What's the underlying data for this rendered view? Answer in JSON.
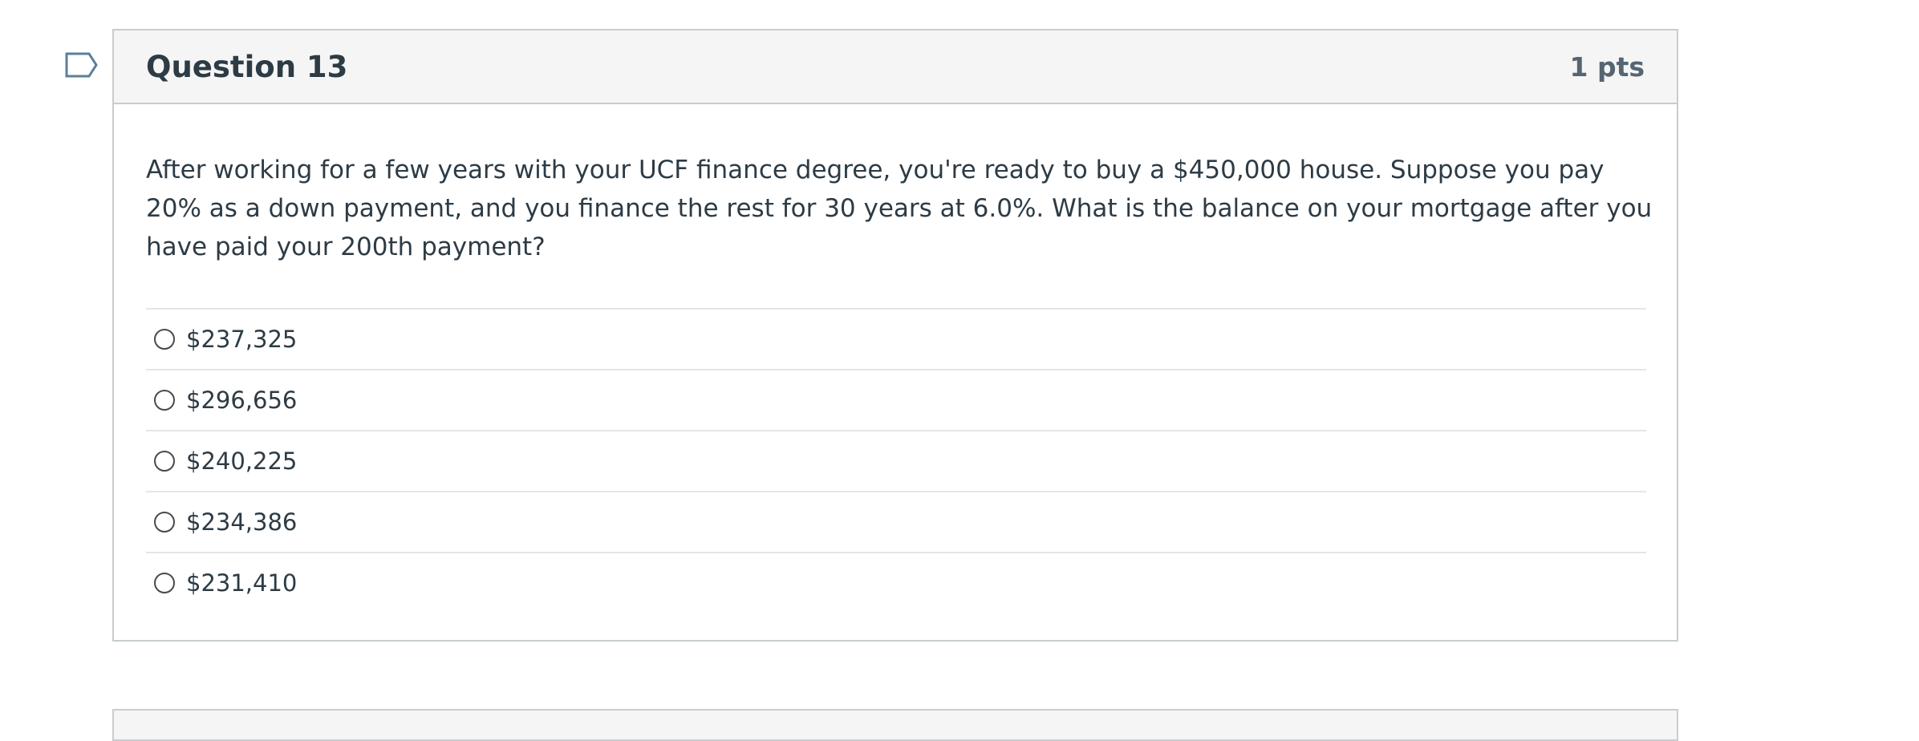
{
  "question": {
    "title": "Question 13",
    "points": "1 pts",
    "text": "After working for a few years with your UCF finance degree, you're ready to buy a $450,000 house. Suppose you pay 20% as a down payment, and you finance the rest for 30 years at 6.0%. What is the balance on your mortgage after you have paid your 200th payment?",
    "answers": [
      {
        "label": "$237,325"
      },
      {
        "label": "$296,656"
      },
      {
        "label": "$240,225"
      },
      {
        "label": "$234,386"
      },
      {
        "label": "$231,410"
      }
    ]
  },
  "colors": {
    "border": "#c7cdd1",
    "header_bg": "#f5f5f5",
    "text": "#2d3b45",
    "flag": "#5b7f9b"
  },
  "icons": {
    "flag": "flag-question-icon",
    "radio": "radio-unselected-icon"
  }
}
